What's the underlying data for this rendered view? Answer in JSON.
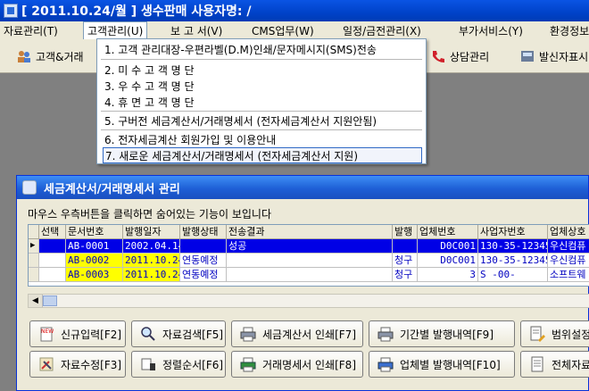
{
  "title": "[ 2011.10.24/월 ]  생수판매   사용자명: /",
  "menus": [
    {
      "label": "자료관리(T)"
    },
    {
      "label": "고객관리(U)"
    },
    {
      "label": "보 고 서(V)"
    },
    {
      "label": "CMS업무(W)"
    },
    {
      "label": "일정/금전관리(X)"
    },
    {
      "label": "부가서비스(Y)"
    },
    {
      "label": "환경정보"
    }
  ],
  "toolbar": {
    "customer": "고객&거래",
    "consult": "상담관리",
    "invoice": "발신자표시"
  },
  "dropdown": {
    "items": [
      "1. 고객 관리대장-우편라벨(D.M)인쇄/문자메시지(SMS)전송",
      "2. 미 수 고 객 명 단",
      "3. 우 수 고 객 명 단",
      "4. 휴 면 고 객 명 단",
      "5. 구버전 세금계산서/거래명세서 (전자세금계산서 지원안됨)",
      "6. 전자세금계산 회원가입 및 이용안내",
      "7. 새로운 세금계산서/거래명세서 (전자세금계산서 지원)"
    ]
  },
  "window": {
    "title": "세금계산서/거래명세서 관리",
    "hint": "마우스 우측버튼을 클릭하면 숨어있는 기능이 보입니다"
  },
  "grid": {
    "headers": [
      "선택",
      "문서번호",
      "발행일자",
      "발행상태",
      "전송결과",
      "발행",
      "업체번호",
      "사업자번호",
      "업체상호"
    ],
    "rows": [
      {
        "sel": "▶",
        "doc": "AB-0001",
        "date": "2002.04.14",
        "status": "",
        "result": "성공",
        "issue": "",
        "company_no": "D0C001",
        "biz_no": "130-35-12345",
        "name": "우신컴퓨"
      },
      {
        "sel": "",
        "doc": "AB-0002",
        "date": "2011.10.24",
        "status": "연동예정",
        "result": "",
        "issue": "청구",
        "company_no": "D0C001",
        "biz_no": "130-35-12345",
        "name": "우신컴퓨"
      },
      {
        "sel": "",
        "doc": "AB-0003",
        "date": "2011.10.24",
        "status": "연동예정",
        "result": "",
        "issue": "청구",
        "company_no": "3",
        "biz_no": "S   -00-",
        "name": "소프트웨"
      }
    ]
  },
  "buttons": {
    "new_entry": "신규입력[F2]",
    "search": "자료검색[F5]",
    "print_tax": "세금계산서 인쇄[F7]",
    "period_history": "기간별 발행내역[F9]",
    "range_setting": "범위설정",
    "edit": "자료수정[F3]",
    "sort": "정렬순서[F6]",
    "print_statement": "거래명세서 인쇄[F8]",
    "company_history": "업체별 발행내역[F10]",
    "all_data": "전체자료"
  }
}
